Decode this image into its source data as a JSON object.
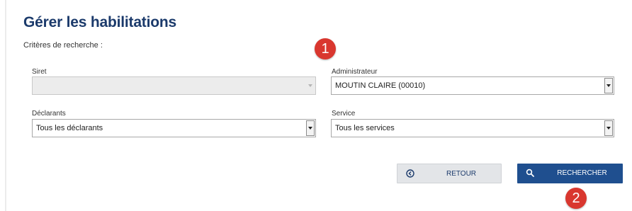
{
  "header": {
    "title": "Gérer les habilitations",
    "criteria_label": "Critères de recherche :"
  },
  "form": {
    "siret": {
      "label": "Siret",
      "value": "",
      "disabled": true
    },
    "administrateur": {
      "label": "Administrateur",
      "value": "MOUTIN CLAIRE (00010)"
    },
    "declarants": {
      "label": "Déclarants",
      "value": "Tous les déclarants"
    },
    "service": {
      "label": "Service",
      "value": "Tous les services"
    }
  },
  "actions": {
    "retour_label": "RETOUR",
    "recherche_label": "RECHERCHER"
  },
  "annotations": {
    "marker_1": "1",
    "marker_2": "2",
    "color": "#d9372f"
  },
  "colors": {
    "title": "#1b3a6b",
    "primary_button": "#1f4f8f",
    "secondary_button": "#e3e5e8"
  }
}
